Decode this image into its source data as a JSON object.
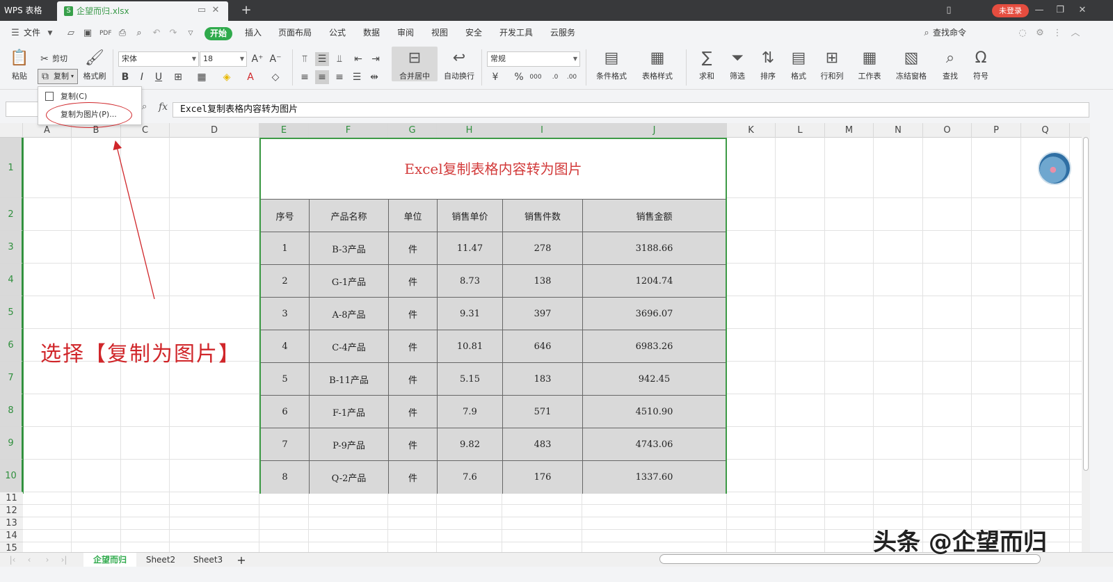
{
  "titlebar": {
    "app_name": "WPS 表格",
    "file_tab": "企望而归.xlsx",
    "login_label": "未登录"
  },
  "menubar": {
    "file": "文件",
    "items": [
      "开始",
      "插入",
      "页面布局",
      "公式",
      "数据",
      "审阅",
      "视图",
      "安全",
      "开发工具",
      "云服务"
    ],
    "search": "查找命令"
  },
  "ribbon": {
    "paste": "粘贴",
    "cut": "剪切",
    "copy": "复制",
    "format_painter": "格式刷",
    "font_name": "宋体",
    "font_size": "18",
    "merge_center": "合并居中",
    "wrap_text": "自动换行",
    "number_format": "常规",
    "cond_format": "条件格式",
    "table_style": "表格样式",
    "sum": "求和",
    "filter": "筛选",
    "sort": "排序",
    "format": "格式",
    "row_col": "行和列",
    "worksheet": "工作表",
    "freeze": "冻结窗格",
    "find": "查找",
    "symbol": "符号"
  },
  "dropdown": {
    "copy": "复制(C)",
    "copy_as_picture": "复制为图片(P)..."
  },
  "formula_bar": {
    "fx": "fx",
    "content": "Excel复制表格内容转为图片"
  },
  "grid": {
    "columns": [
      "A",
      "B",
      "C",
      "D",
      "E",
      "F",
      "G",
      "H",
      "I",
      "J",
      "K",
      "L",
      "M",
      "N",
      "O",
      "P",
      "Q"
    ],
    "rows": [
      "1",
      "2",
      "3",
      "4",
      "5",
      "6",
      "7",
      "8",
      "9",
      "10",
      "11",
      "12",
      "13",
      "14",
      "15"
    ]
  },
  "table": {
    "title": "Excel复制表格内容转为图片",
    "headers": [
      "序号",
      "产品名称",
      "单位",
      "销售单价",
      "销售件数",
      "销售金额"
    ],
    "rows": [
      [
        "1",
        "B-3产品",
        "件",
        "11.47",
        "278",
        "3188.66"
      ],
      [
        "2",
        "G-1产品",
        "件",
        "8.73",
        "138",
        "1204.74"
      ],
      [
        "3",
        "A-8产品",
        "件",
        "9.31",
        "397",
        "3696.07"
      ],
      [
        "4",
        "C-4产品",
        "件",
        "10.81",
        "646",
        "6983.26"
      ],
      [
        "5",
        "B-11产品",
        "件",
        "5.15",
        "183",
        "942.45"
      ],
      [
        "6",
        "F-1产品",
        "件",
        "7.9",
        "571",
        "4510.90"
      ],
      [
        "7",
        "P-9产品",
        "件",
        "9.82",
        "483",
        "4743.06"
      ],
      [
        "8",
        "Q-2产品",
        "件",
        "7.6",
        "176",
        "1337.60"
      ]
    ]
  },
  "annotation": {
    "callout": "选择【复制为图片】",
    "watermark": "头条 @企望而归"
  },
  "sheets": [
    "企望而归",
    "Sheet2",
    "Sheet3"
  ],
  "colors": {
    "accent_green": "#2faa4c",
    "annotation_red": "#d0262a",
    "title_bar": "#38393b"
  }
}
